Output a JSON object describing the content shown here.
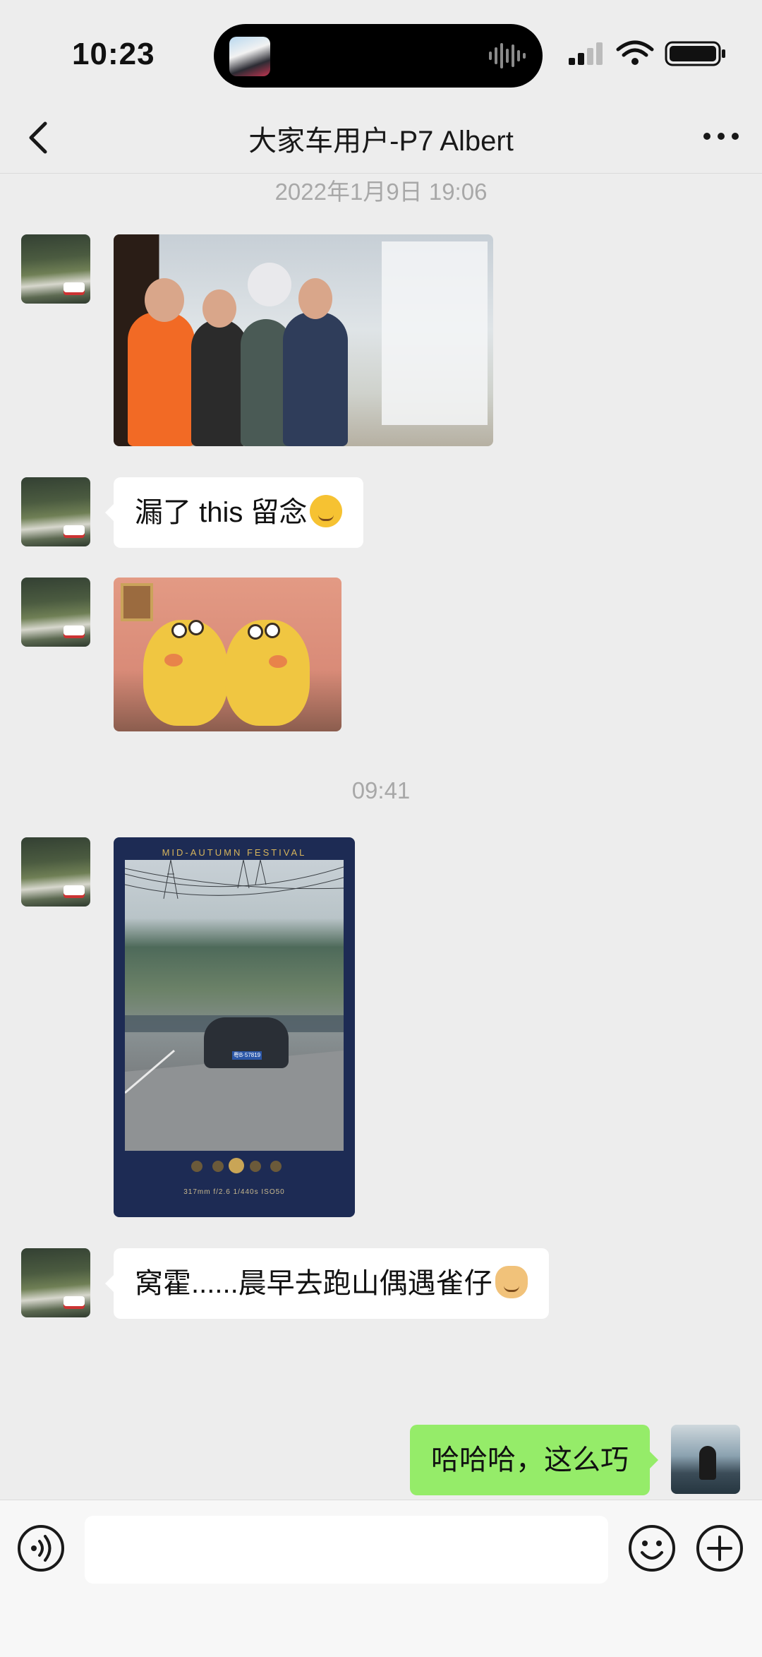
{
  "status_bar": {
    "time": "10:23",
    "icons": [
      "signal-icon",
      "wifi-icon",
      "battery-icon"
    ],
    "dynamic_island": {
      "artwork": "album-art",
      "indicator": "audio-waveform-icon"
    }
  },
  "nav": {
    "back_icon": "chevron-left-icon",
    "title": "大家车用户-P7 Albert",
    "more_icon": "more-dots-icon"
  },
  "timestamps": [
    "2022年1月9日 19:06",
    "09:41"
  ],
  "messages": [
    {
      "from": "other",
      "type": "image",
      "content": "group-photo"
    },
    {
      "from": "other",
      "type": "text",
      "text": "漏了 this 留念",
      "emoji": "smirk-emoji"
    },
    {
      "from": "other",
      "type": "image",
      "content": "chick-sticker"
    },
    {
      "from": "other",
      "type": "image",
      "content": "mid-autumn-poster",
      "poster_title": "MID-AUTUMN FESTIVAL",
      "poster_caption": "317mm  f/2.6  1/440s  ISO50",
      "plate": "粤B·57819"
    },
    {
      "from": "other",
      "type": "text",
      "text": "窝霍......晨早去跑山偶遇雀仔",
      "emoji": "doge-emoji"
    },
    {
      "from": "me",
      "type": "text",
      "text": "哈哈哈，这么巧"
    }
  ],
  "input_bar": {
    "voice_icon": "voice-icon",
    "input_value": "",
    "emoji_icon": "smile-icon",
    "plus_icon": "plus-circle-icon"
  },
  "colors": {
    "background": "#ededed",
    "my_bubble": "#95ec69",
    "other_bubble": "#ffffff",
    "timestamp": "#a8a8a8"
  }
}
